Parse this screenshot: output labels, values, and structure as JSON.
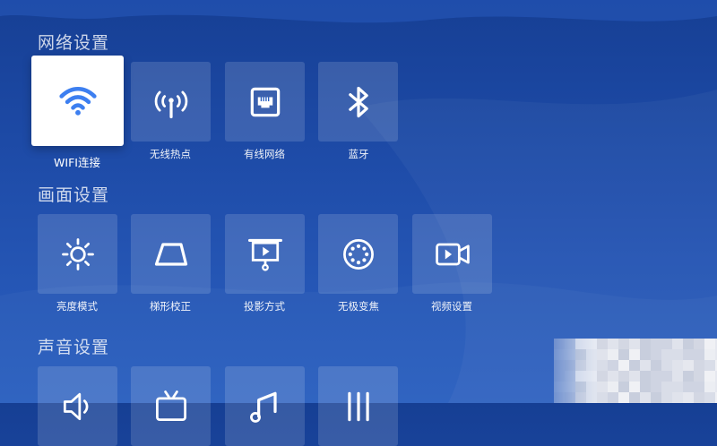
{
  "sections": [
    {
      "title": "网络设置",
      "items": [
        {
          "label": "WIFI连接",
          "icon": "wifi-icon",
          "selected": true
        },
        {
          "label": "无线热点",
          "icon": "hotspot-icon"
        },
        {
          "label": "有线网络",
          "icon": "ethernet-icon"
        },
        {
          "label": "蓝牙",
          "icon": "bluetooth-icon"
        }
      ]
    },
    {
      "title": "画面设置",
      "items": [
        {
          "label": "亮度模式",
          "icon": "brightness-icon"
        },
        {
          "label": "梯形校正",
          "icon": "keystone-icon"
        },
        {
          "label": "投影方式",
          "icon": "projection-icon"
        },
        {
          "label": "无极变焦",
          "icon": "focus-icon"
        },
        {
          "label": "视频设置",
          "icon": "video-camera-icon"
        }
      ]
    },
    {
      "title": "声音设置",
      "items": [
        {
          "icon": "speaker-icon"
        },
        {
          "icon": "sound-device-icon"
        },
        {
          "icon": "music-note-icon"
        },
        {
          "icon": "equalizer-icon"
        }
      ]
    }
  ],
  "colors": {
    "accent": "#3d7ff0",
    "background_top": "#163f94",
    "background_bottom": "#2a5fbf"
  }
}
